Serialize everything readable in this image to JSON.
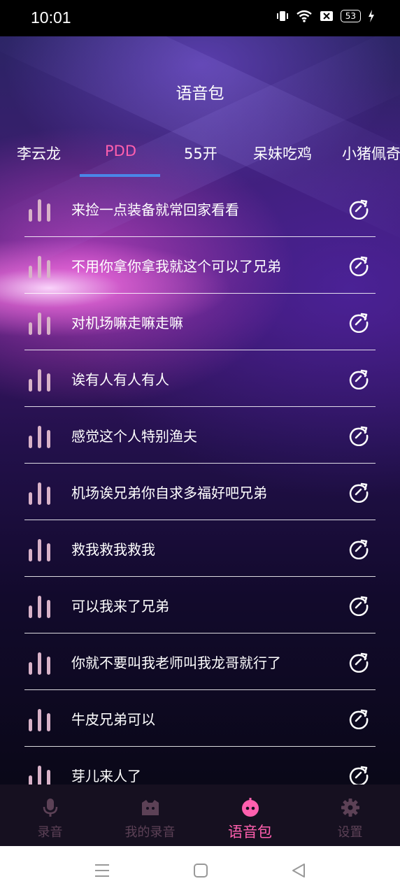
{
  "status": {
    "time": "10:01",
    "battery": "53"
  },
  "header": {
    "title": "语音包"
  },
  "tabs": [
    {
      "label": "李云龙"
    },
    {
      "label": "PDD"
    },
    {
      "label": "55开"
    },
    {
      "label": "呆妹吃鸡"
    },
    {
      "label": "小猪佩奇"
    }
  ],
  "active_tab": "PDD",
  "clips": [
    {
      "text": "来捡一点装备就常回家看看"
    },
    {
      "text": "不用你拿你拿我就这个可以了兄弟"
    },
    {
      "text": "对机场嘛走嘛走嘛"
    },
    {
      "text": "诶有人有人有人"
    },
    {
      "text": "感觉这个人特别渔夫"
    },
    {
      "text": "机场诶兄弟你自求多福好吧兄弟"
    },
    {
      "text": "救我救我救我"
    },
    {
      "text": "可以我来了兄弟"
    },
    {
      "text": "你就不要叫我老师叫我龙哥就行了"
    },
    {
      "text": "牛皮兄弟可以"
    },
    {
      "text": "芽儿来人了"
    }
  ],
  "bottom_nav": [
    {
      "label": "录音",
      "icon": "microphone-icon"
    },
    {
      "label": "我的录音",
      "icon": "folder-icon"
    },
    {
      "label": "语音包",
      "icon": "robot-face-icon"
    },
    {
      "label": "设置",
      "icon": "gear-icon"
    }
  ],
  "colors": {
    "accent": "#ff5fae",
    "indicator": "#4a86e8",
    "nav_inactive": "#5c4156"
  }
}
